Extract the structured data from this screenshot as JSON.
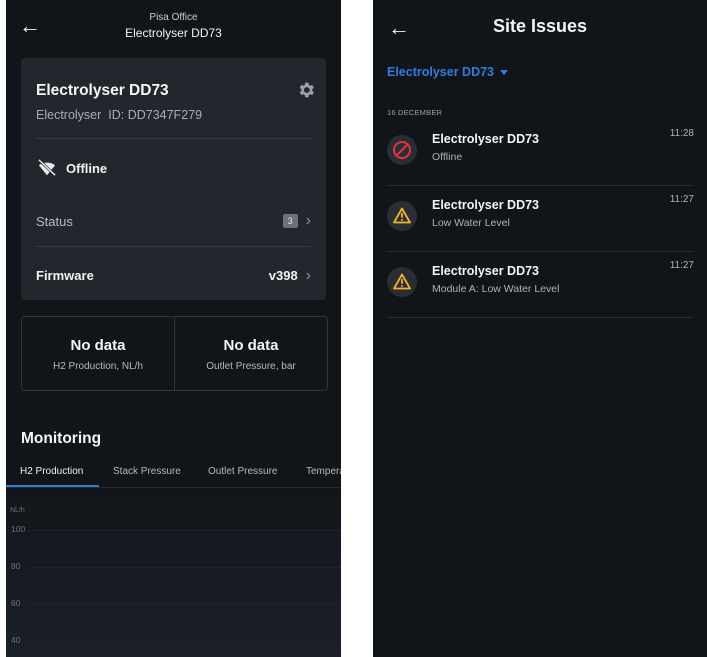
{
  "left": {
    "header": {
      "site": "Pisa Office",
      "title": "Electrolyser DD73"
    },
    "device": {
      "name": "Electrolyser DD73",
      "type": "Electrolyser",
      "id_text": "ID: DD7347F279",
      "connection": "Offline",
      "status_label": "Status",
      "status_count": "3",
      "firmware_label": "Firmware",
      "firmware_value": "v398"
    },
    "stats": [
      {
        "value": "No data",
        "label": "H2 Production, NL/h"
      },
      {
        "value": "No data",
        "label": "Outlet Pressure, bar"
      }
    ],
    "monitoring": {
      "title": "Monitoring",
      "tabs": [
        "H2 Production",
        "Stack Pressure",
        "Outlet Pressure",
        "Temperature"
      ],
      "active_tab": "H2 Production"
    },
    "chart_data": {
      "type": "line",
      "ylabel": "NL/h",
      "yticks": [
        "100",
        "80",
        "60",
        "40"
      ],
      "series": []
    }
  },
  "right": {
    "header": {
      "title": "Site Issues"
    },
    "site_selector": "Electrolyser DD73",
    "date_group": "16 DECEMBER",
    "issues": [
      {
        "title": "Electrolyser DD73",
        "desc": "Offline",
        "time": "11:28",
        "icon": "offline-icon",
        "color": "#e0323c"
      },
      {
        "title": "Electrolyser DD73",
        "desc": "Low Water Level",
        "time": "11:27",
        "icon": "warning-icon",
        "color": "#f0b429"
      },
      {
        "title": "Electrolyser DD73",
        "desc": "Module A: Low Water Level",
        "time": "11:27",
        "icon": "warning-icon",
        "color": "#f0b429"
      }
    ]
  },
  "colors": {
    "accent": "#2f7de0",
    "background": "#111419",
    "card": "#23272d"
  }
}
